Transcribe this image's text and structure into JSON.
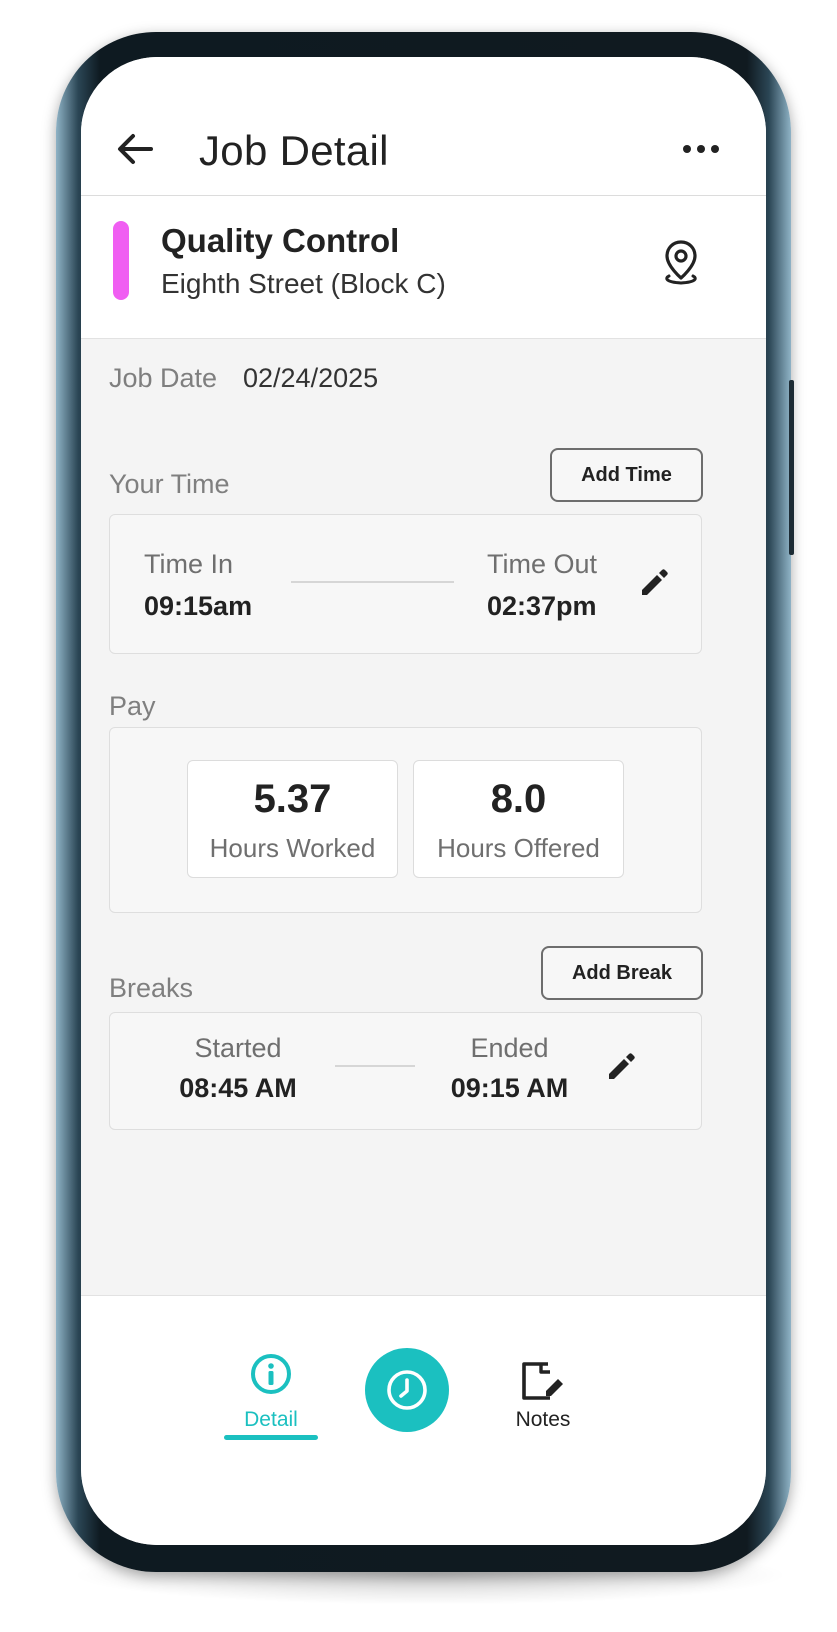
{
  "header": {
    "title": "Job Detail",
    "back_icon": "arrow-left-icon",
    "more_icon": "more-horizontal-icon"
  },
  "job": {
    "name": "Quality Control",
    "location": "Eighth Street (Block C)",
    "accent_color": "#f05ef2",
    "location_icon": "map-pin-icon"
  },
  "job_date": {
    "label": "Job Date",
    "value": "02/24/2025"
  },
  "your_time": {
    "section_label": "Your Time",
    "add_button": "Add Time",
    "time_in_label": "Time In",
    "time_in_value": "09:15am",
    "time_out_label": "Time Out",
    "time_out_value": "02:37pm",
    "edit_icon": "pencil-icon"
  },
  "pay": {
    "section_label": "Pay",
    "stats": [
      {
        "value": "5.37",
        "caption": "Hours Worked"
      },
      {
        "value": "8.0",
        "caption": "Hours Offered"
      }
    ]
  },
  "breaks": {
    "section_label": "Breaks",
    "add_button": "Add Break",
    "started_label": "Started",
    "started_value": "08:45 AM",
    "ended_label": "Ended",
    "ended_value": "09:15 AM",
    "edit_icon": "pencil-icon"
  },
  "bottom_nav": {
    "items": [
      {
        "label": "Detail",
        "icon": "info-circle-icon",
        "active": true
      },
      {
        "label": "",
        "icon": "clock-icon",
        "active": false
      },
      {
        "label": "Notes",
        "icon": "note-edit-icon",
        "active": false
      }
    ],
    "accent_color": "#1bc0c0"
  }
}
